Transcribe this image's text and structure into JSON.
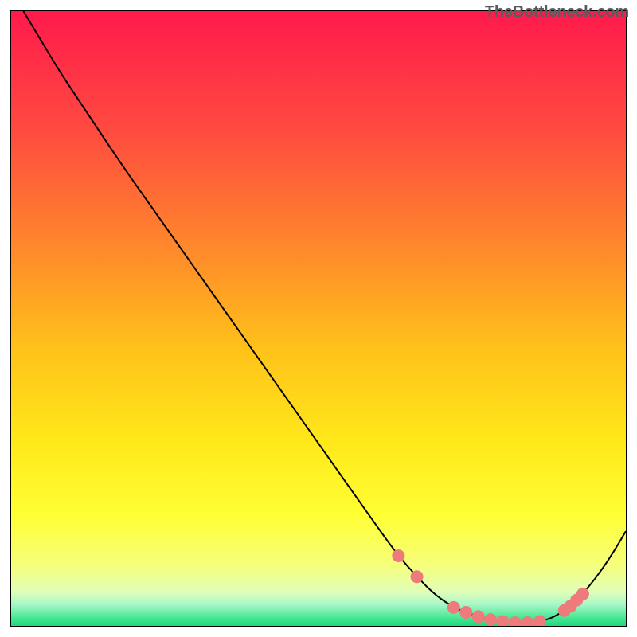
{
  "attribution": "TheBottleneck.com",
  "chart_data": {
    "type": "line",
    "title": "",
    "xlabel": "",
    "ylabel": "",
    "xlim": [
      0,
      100
    ],
    "ylim": [
      0,
      100
    ],
    "gradient_stops": [
      {
        "offset": 0.0,
        "color": "#ff1a4c"
      },
      {
        "offset": 0.2,
        "color": "#ff4c3f"
      },
      {
        "offset": 0.4,
        "color": "#ff8d2a"
      },
      {
        "offset": 0.55,
        "color": "#ffc21a"
      },
      {
        "offset": 0.7,
        "color": "#ffe81a"
      },
      {
        "offset": 0.82,
        "color": "#ffff33"
      },
      {
        "offset": 0.9,
        "color": "#f6ff7a"
      },
      {
        "offset": 0.945,
        "color": "#e0ffb8"
      },
      {
        "offset": 0.965,
        "color": "#a8f7c8"
      },
      {
        "offset": 0.985,
        "color": "#4fe897"
      },
      {
        "offset": 1.0,
        "color": "#1ed97f"
      }
    ],
    "curve_data": {
      "description": "Bottleneck percentage vs component index; V-shaped with minimum near the optimal GPU/CPU match.",
      "x": [
        2,
        5,
        8,
        12,
        18,
        24,
        30,
        36,
        42,
        48,
        54,
        60,
        63,
        66,
        69,
        72,
        75,
        78,
        80,
        82,
        84,
        86,
        88,
        90,
        92,
        94,
        96,
        98,
        100
      ],
      "y": [
        100,
        95,
        90,
        84,
        75,
        66.5,
        58,
        49.5,
        41,
        32.5,
        24,
        15.5,
        11.4,
        8.0,
        5.0,
        3.0,
        1.8,
        1.0,
        0.7,
        0.5,
        0.5,
        0.7,
        1.3,
        2.5,
        4.2,
        6.4,
        9.0,
        12.0,
        15.4
      ]
    },
    "marker_data": {
      "description": "Highlighted data points near the trough of the curve (optimal region).",
      "points": [
        {
          "x": 63,
          "y": 11.4
        },
        {
          "x": 66,
          "y": 8.0
        },
        {
          "x": 72,
          "y": 3.0
        },
        {
          "x": 74,
          "y": 2.2
        },
        {
          "x": 76,
          "y": 1.5
        },
        {
          "x": 78,
          "y": 1.0
        },
        {
          "x": 80,
          "y": 0.7
        },
        {
          "x": 82,
          "y": 0.5
        },
        {
          "x": 84,
          "y": 0.5
        },
        {
          "x": 86,
          "y": 0.7
        },
        {
          "x": 90,
          "y": 2.5
        },
        {
          "x": 91,
          "y": 3.2
        },
        {
          "x": 92,
          "y": 4.2
        },
        {
          "x": 93,
          "y": 5.2
        }
      ]
    },
    "colors": {
      "curve": "#000000",
      "marker": "#ed7b7b",
      "border": "#000000",
      "text": "#5c5c5c"
    }
  }
}
